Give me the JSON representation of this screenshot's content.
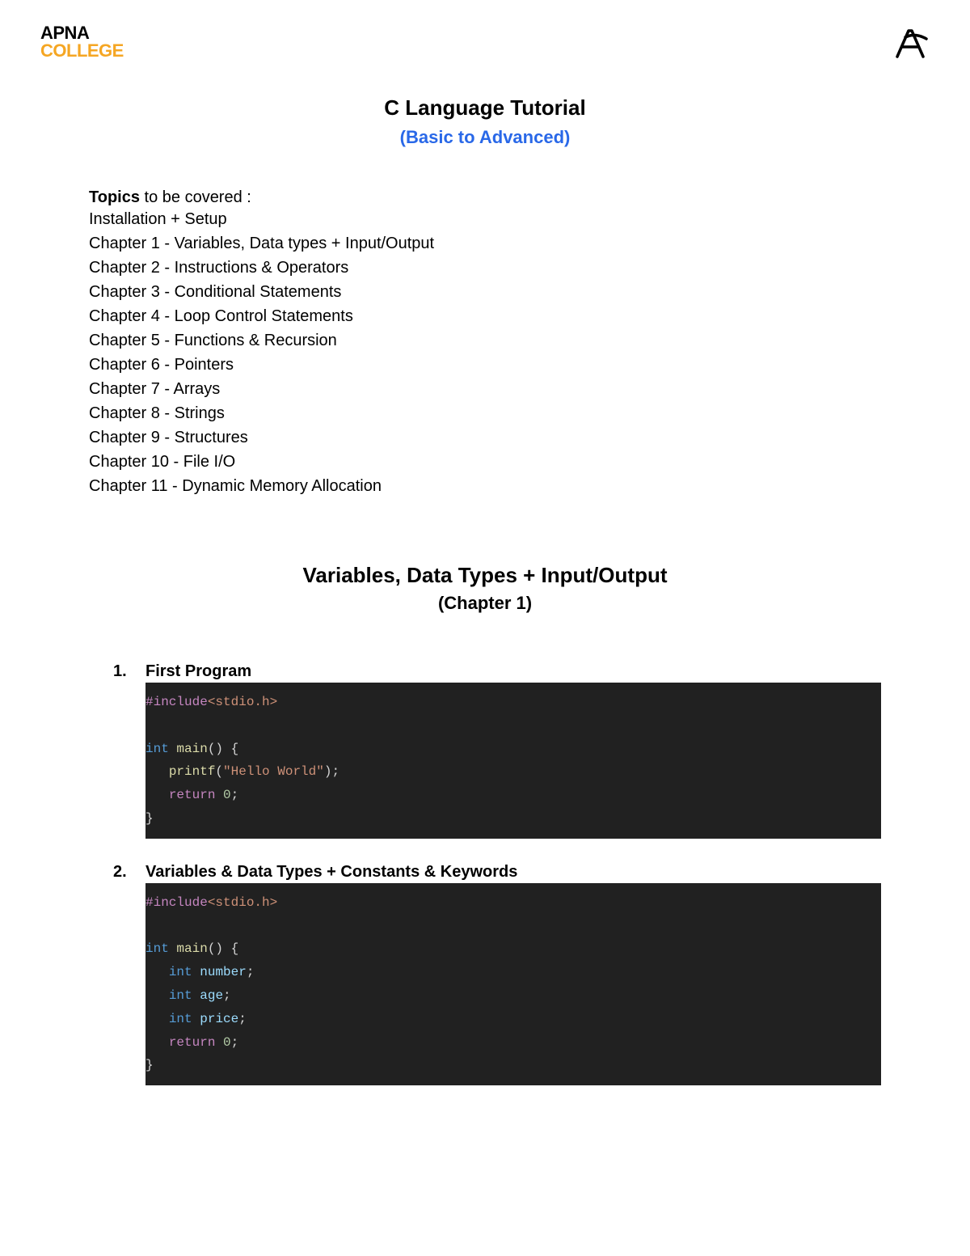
{
  "header": {
    "logo_top": "APNA",
    "logo_bottom": "COLLEGE"
  },
  "title": "C Language Tutorial",
  "subtitle": "(Basic to Advanced)",
  "topics": {
    "label_bold": "Topics",
    "label_rest": " to be covered :",
    "items": [
      "Installation + Setup",
      "Chapter 1 - Variables, Data types + Input/Output",
      "Chapter 2 - Instructions & Operators",
      "Chapter 3 - Conditional Statements",
      "Chapter 4 - Loop Control Statements",
      "Chapter 5 - Functions & Recursion",
      "Chapter 6 - Pointers",
      "Chapter 7 - Arrays",
      "Chapter 8 - Strings",
      "Chapter 9 - Structures",
      "Chapter 10 - File I/O",
      "Chapter 11 - Dynamic Memory Allocation"
    ]
  },
  "chapter": {
    "title": "Variables, Data Types + Input/Output",
    "subtitle": "(Chapter 1)"
  },
  "sections": [
    {
      "number": "1.",
      "title": "First Program",
      "code": {
        "include": "#include",
        "include_path": "<stdio.h>",
        "lines": [
          {
            "tokens": [
              {
                "t": "keyword-type",
                "s": "int"
              },
              {
                "t": "punct",
                "s": " "
              },
              {
                "t": "fn-name",
                "s": "main"
              },
              {
                "t": "punct",
                "s": "() {"
              }
            ]
          },
          {
            "tokens": [
              {
                "t": "punct",
                "s": "   "
              },
              {
                "t": "fn-name",
                "s": "printf"
              },
              {
                "t": "punct",
                "s": "("
              },
              {
                "t": "string",
                "s": "\"Hello World\""
              },
              {
                "t": "punct",
                "s": ");"
              }
            ]
          },
          {
            "tokens": [
              {
                "t": "punct",
                "s": "   "
              },
              {
                "t": "keyword-ctrl",
                "s": "return"
              },
              {
                "t": "punct",
                "s": " "
              },
              {
                "t": "number",
                "s": "0"
              },
              {
                "t": "punct",
                "s": ";"
              }
            ]
          },
          {
            "tokens": [
              {
                "t": "punct",
                "s": "}"
              }
            ]
          }
        ]
      }
    },
    {
      "number": "2.",
      "title": "Variables & Data Types + Constants & Keywords",
      "code": {
        "include": "#include",
        "include_path": "<stdio.h>",
        "lines": [
          {
            "tokens": [
              {
                "t": "keyword-type",
                "s": "int"
              },
              {
                "t": "punct",
                "s": " "
              },
              {
                "t": "fn-name",
                "s": "main"
              },
              {
                "t": "punct",
                "s": "() {"
              }
            ]
          },
          {
            "tokens": [
              {
                "t": "punct",
                "s": "   "
              },
              {
                "t": "keyword-type",
                "s": "int"
              },
              {
                "t": "punct",
                "s": " "
              },
              {
                "t": "ident",
                "s": "number"
              },
              {
                "t": "punct",
                "s": ";"
              }
            ]
          },
          {
            "tokens": [
              {
                "t": "punct",
                "s": "   "
              },
              {
                "t": "keyword-type",
                "s": "int"
              },
              {
                "t": "punct",
                "s": " "
              },
              {
                "t": "ident",
                "s": "age"
              },
              {
                "t": "punct",
                "s": ";"
              }
            ]
          },
          {
            "tokens": [
              {
                "t": "punct",
                "s": "   "
              },
              {
                "t": "keyword-type",
                "s": "int"
              },
              {
                "t": "punct",
                "s": " "
              },
              {
                "t": "ident",
                "s": "price"
              },
              {
                "t": "punct",
                "s": ";"
              }
            ]
          },
          {
            "tokens": [
              {
                "t": "punct",
                "s": "   "
              },
              {
                "t": "keyword-ctrl",
                "s": "return"
              },
              {
                "t": "punct",
                "s": " "
              },
              {
                "t": "number",
                "s": "0"
              },
              {
                "t": "punct",
                "s": ";"
              }
            ]
          },
          {
            "tokens": [
              {
                "t": "punct",
                "s": "}"
              }
            ]
          }
        ]
      }
    }
  ]
}
